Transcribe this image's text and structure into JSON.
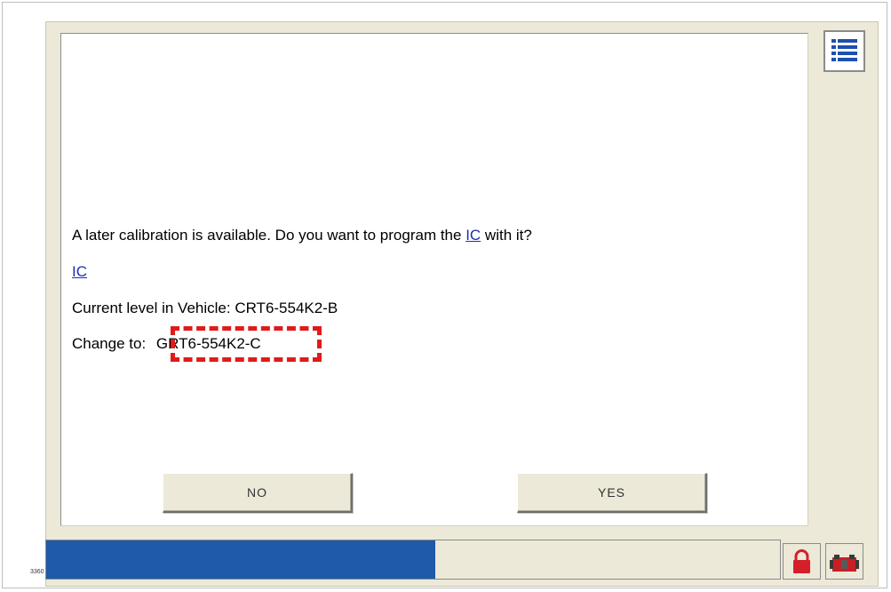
{
  "message": {
    "prompt_before": "A later calibration is available.  Do you want to program the ",
    "prompt_link": "IC",
    "prompt_after": " with it?",
    "module_link": "IC",
    "current_level": "Current level in Vehicle:  CRT6-554K2-B",
    "change_to_label": "Change to:",
    "change_to_value": "GRT6-554K2-C"
  },
  "buttons": {
    "no": "NO",
    "yes": "YES"
  },
  "progress": {
    "fraction": 0.53,
    "color": "#1f5aa8"
  },
  "icons": [
    "menu-list-icon",
    "lock-icon",
    "vehicle-connector-icon"
  ],
  "colors": {
    "highlight": "#e01b1b",
    "link": "#1f2fb5",
    "window_bg": "#ece9d8"
  },
  "figure_id": "3360"
}
